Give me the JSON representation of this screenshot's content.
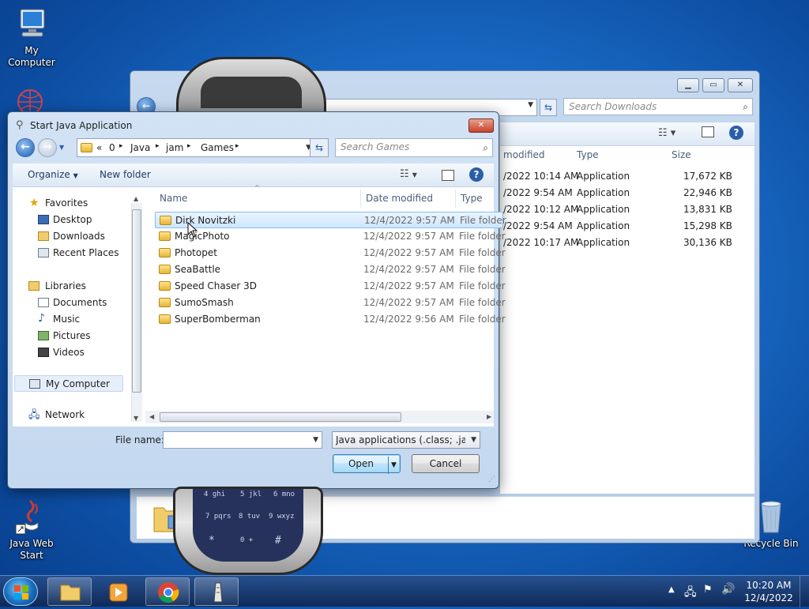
{
  "desktop": {
    "icons": [
      {
        "label": "My Computer"
      },
      {
        "label": "Java Web Start"
      },
      {
        "label": "Recycle Bin"
      }
    ]
  },
  "phone": {
    "keys": [
      "4 ghi",
      "5 jkl",
      "6 mno",
      "7 pqrs",
      "8 tuv",
      "9 wxyz",
      "*",
      "0 +",
      "#"
    ]
  },
  "bg_window": {
    "search_placeholder": "Search Downloads",
    "columns": {
      "date": "modified",
      "type": "Type",
      "size": "Size"
    },
    "rows": [
      {
        "date": "/2022 10:14 AM",
        "type": "Application",
        "size": "17,672 KB"
      },
      {
        "date": "/2022 9:54 AM",
        "type": "Application",
        "size": "22,946 KB"
      },
      {
        "date": "/2022 10:12 AM",
        "type": "Application",
        "size": "13,831 KB"
      },
      {
        "date": "/2022 9:54 AM",
        "type": "Application",
        "size": "15,298 KB"
      },
      {
        "date": "/2022 10:17 AM",
        "type": "Application",
        "size": "30,136 KB"
      }
    ]
  },
  "dialog": {
    "title": "Start Java Application",
    "breadcrumb": [
      "«",
      "0",
      "Java",
      "jam",
      "Games"
    ],
    "search_placeholder": "Search Games",
    "toolbar": {
      "organize": "Organize",
      "new_folder": "New folder"
    },
    "nav": {
      "favorites": "Favorites",
      "desktop": "Desktop",
      "downloads": "Downloads",
      "recent": "Recent Places",
      "libraries": "Libraries",
      "documents": "Documents",
      "music": "Music",
      "pictures": "Pictures",
      "videos": "Videos",
      "computer": "My Computer",
      "network": "Network"
    },
    "columns": {
      "name": "Name",
      "date": "Date modified",
      "type": "Type"
    },
    "files": [
      {
        "name": "Dirk Novitzki",
        "date": "12/4/2022 9:57 AM",
        "type": "File folder"
      },
      {
        "name": "MagicPhoto",
        "date": "12/4/2022 9:57 AM",
        "type": "File folder"
      },
      {
        "name": "Photopet",
        "date": "12/4/2022 9:57 AM",
        "type": "File folder"
      },
      {
        "name": "SeaBattle",
        "date": "12/4/2022 9:57 AM",
        "type": "File folder"
      },
      {
        "name": "Speed Chaser 3D",
        "date": "12/4/2022 9:57 AM",
        "type": "File folder"
      },
      {
        "name": "SumoSmash",
        "date": "12/4/2022 9:57 AM",
        "type": "File folder"
      },
      {
        "name": "SuperBomberman",
        "date": "12/4/2022 9:56 AM",
        "type": "File folder"
      }
    ],
    "filename_label": "File name:",
    "filename_value": "",
    "filetype": "Java applications (.class; .jar; .jad)",
    "open_label": "Open",
    "cancel_label": "Cancel"
  },
  "taskbar": {
    "time": "10:20 AM",
    "date": "12/4/2022"
  }
}
